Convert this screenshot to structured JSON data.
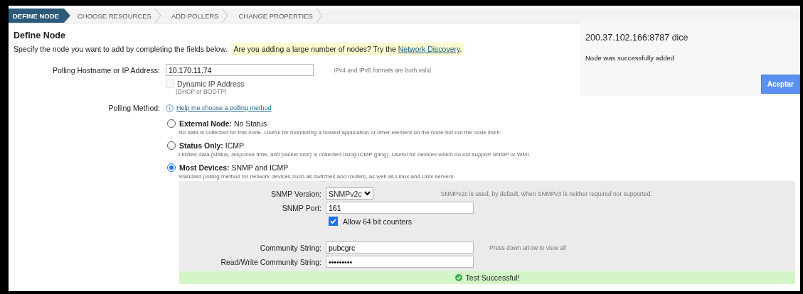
{
  "breadcrumb": [
    {
      "label": "DEFINE NODE",
      "selected": true
    },
    {
      "label": "CHOOSE RESOURCES",
      "selected": false
    },
    {
      "label": "ADD POLLERS",
      "selected": false
    },
    {
      "label": "CHANGE PROPERTIES",
      "selected": false
    }
  ],
  "heading": "Define Node",
  "intro": "Specify the node you want to add by completing the fields below.",
  "tip": {
    "text": "Are you adding a large number of nodes? Try the ",
    "link": "Network Discovery",
    "end": "."
  },
  "hostname": {
    "label": "Polling Hostname or IP Address:",
    "value": "10.170.11.74",
    "hint": "IPv4 and IPv6 formats are both valid"
  },
  "dynamic_ip": {
    "label": "Dynamic IP Address",
    "note": "(DHCP or BOOTP)",
    "checked": false,
    "disabled": true
  },
  "polling_method": {
    "label": "Polling Method:",
    "help_link": "Help me choose a polling method",
    "options": [
      {
        "title": "External Node:",
        "subtitle": "No Status",
        "description": "No data is collected for this node. Useful for monitoring a hosted application or other element on the node but not the node itself.",
        "selected": false
      },
      {
        "title": "Status Only:",
        "subtitle": "ICMP",
        "description": "Limited data (status, response time, and packet loss) is collected using ICMP (ping). Useful for devices which do not support SNMP or WMI.",
        "selected": false
      },
      {
        "title": "Most Devices:",
        "subtitle": "SNMP and ICMP",
        "description": "Standard polling method for network devices such as switches and routers, as well as Linux and Unix servers.",
        "selected": true
      }
    ]
  },
  "snmp": {
    "version": {
      "label": "SNMP Version:",
      "value": "SNMPv2c",
      "hint": "SNMPv2c is used, by default, when SNMPv3 is neither required nor supported."
    },
    "port": {
      "label": "SNMP Port:",
      "value": "161"
    },
    "allow_64bit": {
      "label": "Allow 64 bit counters",
      "checked": true
    },
    "community": {
      "label": "Community String:",
      "value": "pubcgrc",
      "hint": "Press down arrow to view all"
    },
    "rw_community": {
      "label": "Read/Write Community String:",
      "value": "•••••••••"
    }
  },
  "test_result": "Test Successful!",
  "dialog": {
    "origin": "200.37.102.166:8787 dice",
    "message": "Node was successfully added",
    "button": "Aceptar"
  }
}
